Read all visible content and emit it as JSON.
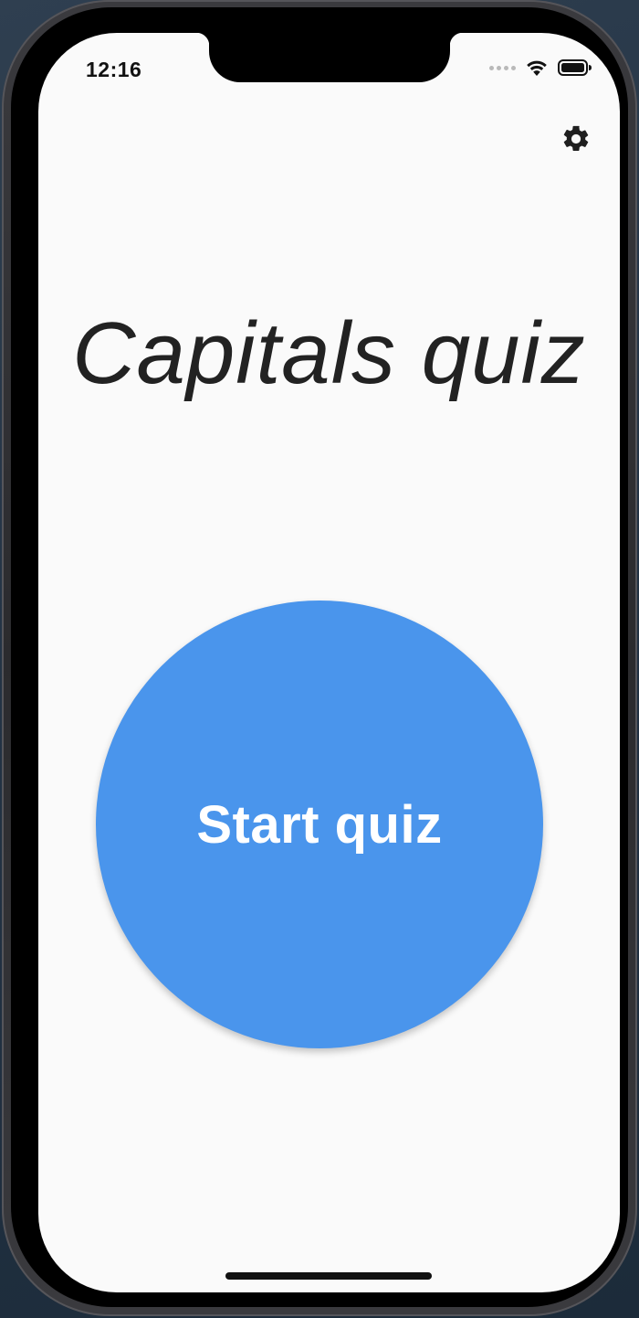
{
  "status_bar": {
    "time": "12:16"
  },
  "header": {
    "settings_icon": "gear-icon"
  },
  "main": {
    "title": "Capitals quiz",
    "start_button_label": "Start quiz"
  },
  "colors": {
    "screen_background": "#fafafa",
    "start_button": "#4a95ec",
    "title_text": "#222222",
    "icon": "#1f1f1f"
  }
}
